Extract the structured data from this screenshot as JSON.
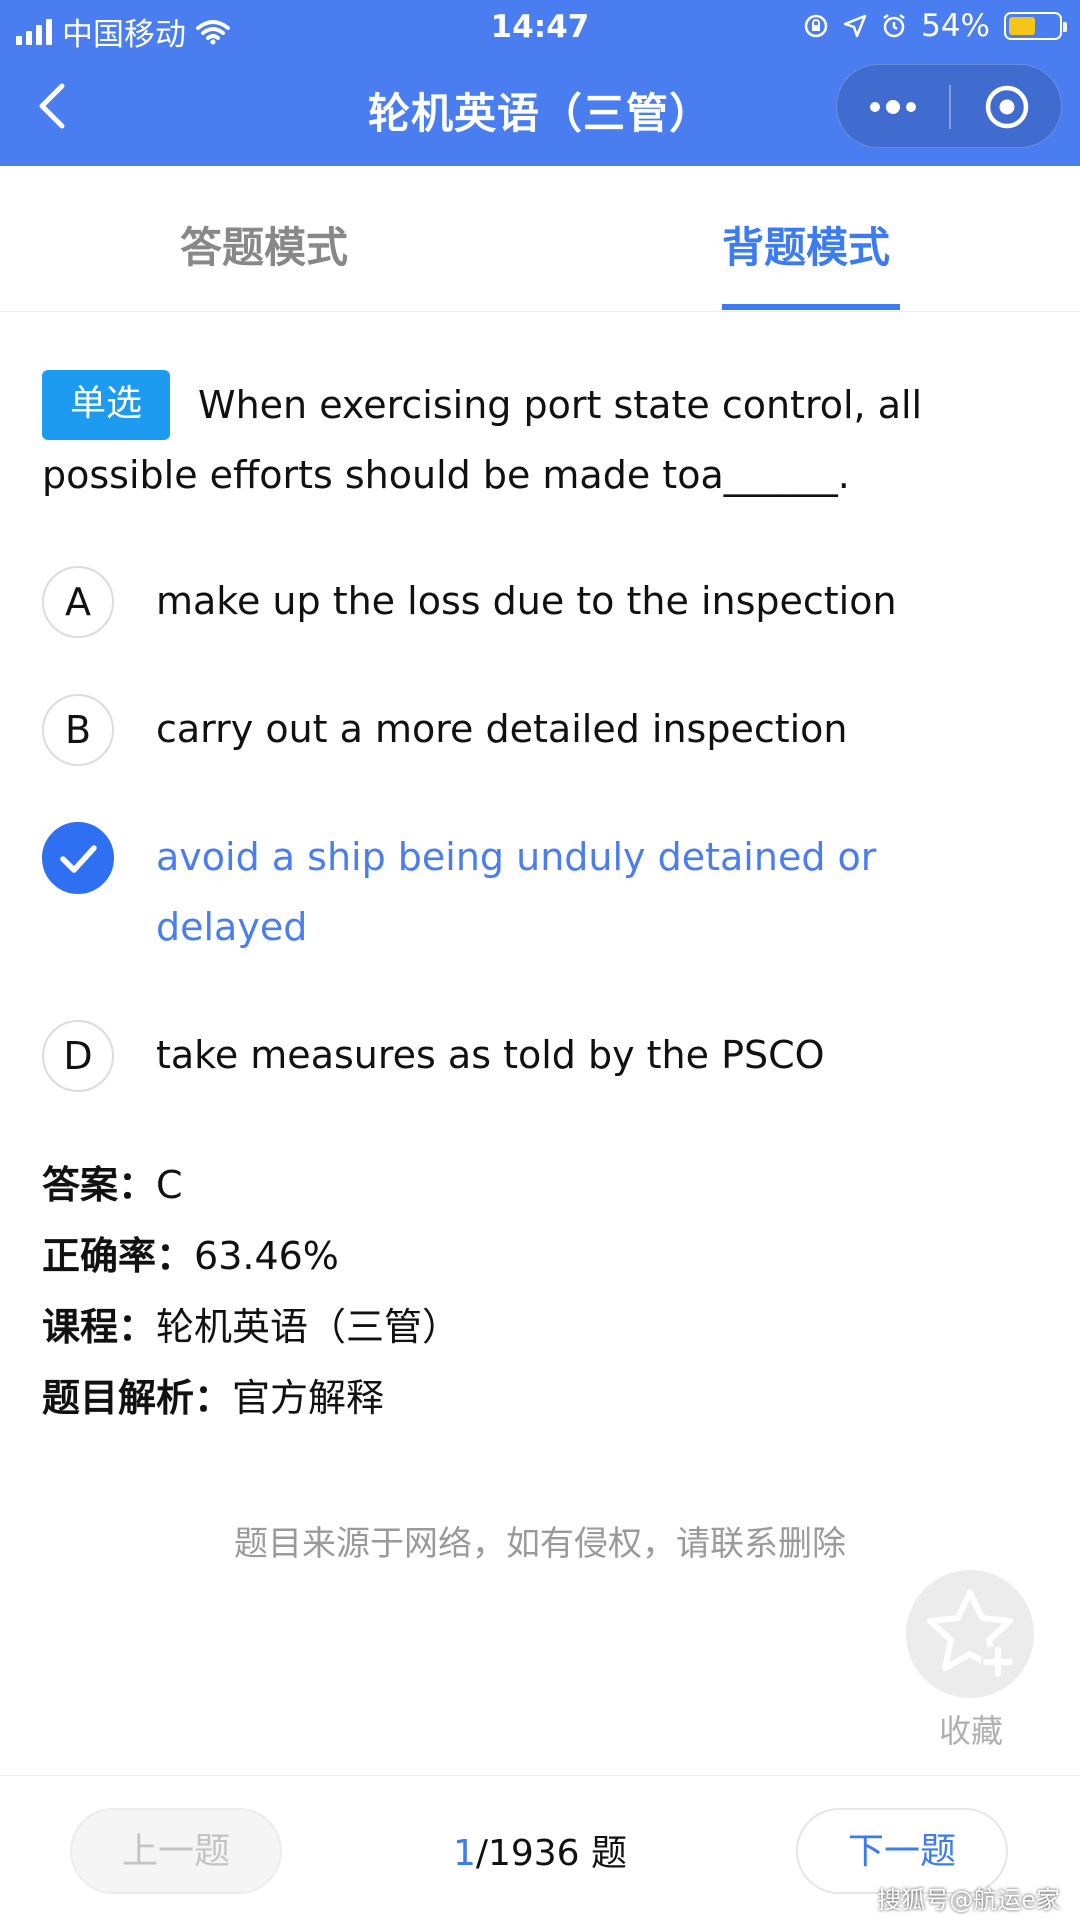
{
  "status": {
    "carrier": "中国移动",
    "time": "14:47",
    "battery": "54%",
    "battery_level": 0.54
  },
  "nav": {
    "title": "轮机英语（三管）"
  },
  "tabs": [
    {
      "label": "答题模式",
      "active": false
    },
    {
      "label": "背题模式",
      "active": true
    }
  ],
  "question": {
    "type_badge": "单选",
    "text": "When exercising port state control, all possible efforts should be made toa______."
  },
  "options": [
    {
      "letter": "A",
      "text": "make up the loss due to the inspection",
      "selected": false
    },
    {
      "letter": "B",
      "text": "carry out a more detailed inspection",
      "selected": false
    },
    {
      "letter": "C",
      "text": "avoid a ship being unduly detained or delayed",
      "selected": true
    },
    {
      "letter": "D",
      "text": "take measures as told by the PSCO",
      "selected": false
    }
  ],
  "info": {
    "answer_label": "答案：",
    "answer_value": "C",
    "accuracy_label": "正确率：",
    "accuracy_value": "63.46%",
    "course_label": "课程：",
    "course_value": "轮机英语（三管）",
    "analysis_label": "题目解析：",
    "analysis_value": "官方解释"
  },
  "disclaimer": "题目来源于网络，如有侵权，请联系删除",
  "favorite": {
    "label": "收藏"
  },
  "footer": {
    "prev_label": "上一题",
    "next_label": "下一题",
    "current": "1",
    "total": "/1936 题"
  },
  "watermark": "搜狐号@航运e家",
  "colors": {
    "primary": "#4a7ef0",
    "badge": "#1c9bf0",
    "battery_fill": "#f5c517"
  }
}
